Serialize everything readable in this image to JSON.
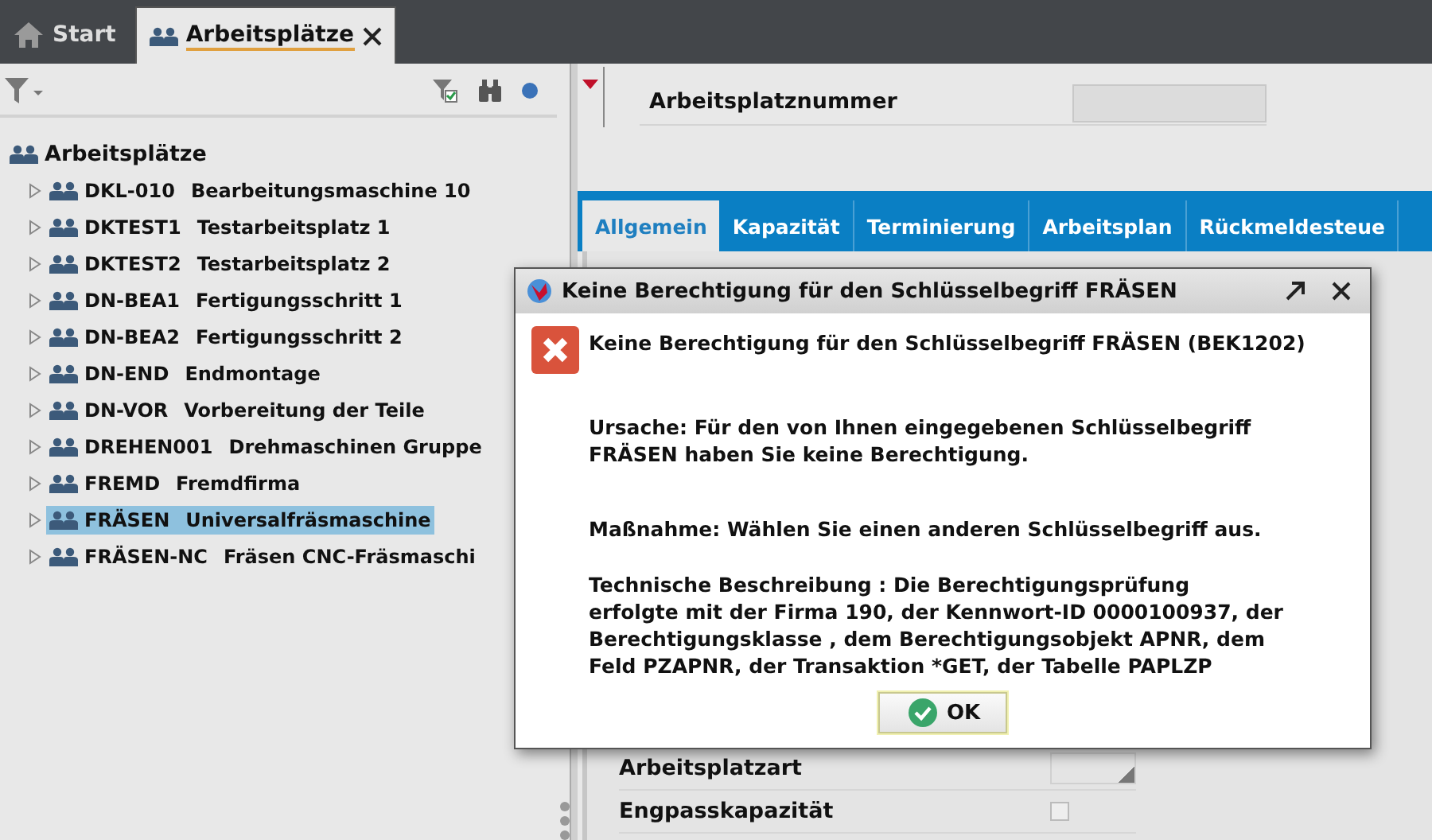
{
  "top_tabs": [
    {
      "label": "Start",
      "kind": "home",
      "selected": false,
      "closable": false
    },
    {
      "label": "Arbeitsplätze",
      "kind": "workstation",
      "selected": true,
      "closable": true
    }
  ],
  "tree": {
    "label": "Arbeitsplätze",
    "expanded": true,
    "children": [
      {
        "code": "DKL-010",
        "name": "Bearbeitungsmaschine 10",
        "expanded": false,
        "selected": false
      },
      {
        "code": "DKTEST1",
        "name": "Testarbeitsplatz 1",
        "expanded": false,
        "selected": false
      },
      {
        "code": "DKTEST2",
        "name": "Testarbeitsplatz 2",
        "expanded": false,
        "selected": false
      },
      {
        "code": "DN-BEA1",
        "name": "Fertigungsschritt 1",
        "expanded": false,
        "selected": false
      },
      {
        "code": "DN-BEA2",
        "name": "Fertigungsschritt 2",
        "expanded": false,
        "selected": false
      },
      {
        "code": "DN-END",
        "name": "Endmontage",
        "expanded": false,
        "selected": false
      },
      {
        "code": "DN-VOR",
        "name": "Vorbereitung der Teile",
        "expanded": false,
        "selected": false
      },
      {
        "code": "DREHEN001",
        "name": "Drehmaschinen Gruppe",
        "expanded": false,
        "selected": false
      },
      {
        "code": "FREMD",
        "name": "Fremdfirma",
        "expanded": false,
        "selected": false
      },
      {
        "code": "FRÄSEN",
        "name": "Universalfräsmaschine",
        "expanded": false,
        "selected": true
      },
      {
        "code": "FRÄSEN-NC",
        "name": "Fräsen CNC-Fräsmaschi",
        "expanded": false,
        "selected": false
      }
    ]
  },
  "header_field": {
    "label": "Arbeitsplatznummer"
  },
  "detail_tabs": [
    {
      "label": "Allgemein",
      "selected": true
    },
    {
      "label": "Kapazität",
      "selected": false
    },
    {
      "label": "Terminierung",
      "selected": false
    },
    {
      "label": "Arbeitsplan",
      "selected": false
    },
    {
      "label": "Rückmeldesteue",
      "selected": false
    }
  ],
  "form_rows": [
    {
      "label": "Arbeitsplatzart",
      "kind": "dropdown"
    },
    {
      "label": "Engpasskapazität",
      "kind": "checkbox",
      "checked": false
    }
  ],
  "dialog": {
    "title": "Keine Berechtigung für den Schlüsselbegriff FRÄSEN",
    "heading": "Keine Berechtigung für den Schlüsselbegriff FRÄSEN (BEK1202)",
    "paragraphs": [
      "Ursache: Für den von Ihnen eingegebenen Schlüsselbegriff\nFRÄSEN haben Sie keine Berechtigung.",
      "Maßnahme: Wählen Sie einen anderen Schlüsselbegriff aus.",
      "Technische Beschreibung : Die Berechtigungsprüfung\nerfolgte mit der Firma 190, der Kennwort-ID 0000100937, der\nBerechtigungsklasse , dem Berechtigungsobjekt APNR, dem\nFeld PZAPNR, der Transaktion *GET, der Tabelle PAPLZP"
    ],
    "button": "OK"
  }
}
